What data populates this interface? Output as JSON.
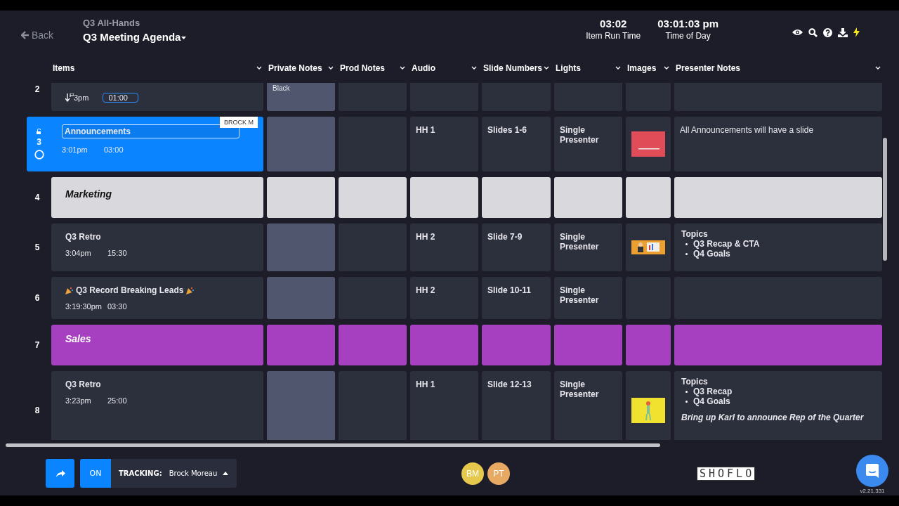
{
  "header": {
    "back": {
      "label": "Back",
      "disabled": true
    },
    "show": "Q3 All-Hands",
    "rundown": "Q3 Meeting Agenda",
    "timers": [
      {
        "value": "03:02",
        "label": "Item Run Time"
      },
      {
        "value": "03:01:03 pm",
        "label": "Time of Day"
      }
    ]
  },
  "columns": [
    "Items",
    "Private Notes",
    "Prod Notes",
    "Audio",
    "Slide Numbers",
    "Lights",
    "Images",
    "Presenter Notes"
  ],
  "rows": [
    {
      "number": "2",
      "kind": "item",
      "selected": false,
      "title": "",
      "start": "3pm",
      "start_icon": true,
      "duration": "01:00",
      "duration_editing": true,
      "private_notes": "Black",
      "prod_notes": "",
      "audio": "",
      "slide_numbers": "",
      "lights": ""
    },
    {
      "number": "3",
      "kind": "item",
      "selected": true,
      "tracker": "BROCK M",
      "title": "Announcements",
      "party": false,
      "start_icon": false,
      "title_editing": true,
      "start": "3:01pm",
      "duration": "03:00",
      "duration_editing": false,
      "private_notes": "",
      "prod_notes": "",
      "audio": "HH 1",
      "slide_numbers": "Slides 1-6",
      "lights": "Single Presenter",
      "image": {
        "kind": "slide"
      },
      "presenter_notes": {
        "kind": "text",
        "text": "All Announcements will have a slide"
      }
    },
    {
      "number": "4",
      "kind": "section",
      "title": "Marketing",
      "color": "#d9d9dd"
    },
    {
      "number": "5",
      "kind": "item",
      "selected": false,
      "title": "Q3 Retro",
      "party": false,
      "start_icon": false,
      "title_editing": false,
      "start": "3:04pm",
      "duration": "15:30",
      "duration_editing": false,
      "private_notes": "",
      "prod_notes": "",
      "audio": "HH 2",
      "slide_numbers": "Slide 7-9",
      "lights": "Single Presenter",
      "image": {
        "kind": "presenter"
      },
      "presenter_notes": {
        "kind": "topics",
        "heading": "Topics",
        "bullets": [
          "Q3 Recap & CTA",
          "Q4 Goals"
        ]
      }
    },
    {
      "number": "6",
      "kind": "item",
      "selected": false,
      "title": "Q3 Record Breaking Leads",
      "party": true,
      "start_icon": false,
      "title_editing": false,
      "start": "3:19:30pm",
      "duration": "03:30",
      "duration_editing": false,
      "private_notes": "",
      "prod_notes": "",
      "audio": "HH 2",
      "slide_numbers": "Slide 10-11",
      "lights": "Single Presenter"
    },
    {
      "number": "7",
      "kind": "section",
      "title": "Sales",
      "color": "#a640c1"
    },
    {
      "number": "8",
      "kind": "item",
      "selected": false,
      "title": "Q3 Retro",
      "party": false,
      "start_icon": false,
      "title_editing": false,
      "start": "3:23pm",
      "duration": "25:00",
      "duration_editing": false,
      "private_notes": "",
      "prod_notes": "",
      "audio": "HH 1",
      "slide_numbers": "Slide 12-13",
      "lights": "Single Presenter",
      "image": {
        "kind": "figure"
      },
      "presenter_notes": {
        "kind": "topics",
        "heading": "Topics",
        "bullets": [
          "Q3 Recap",
          "Q4 Goals"
        ],
        "note": "Bring up Karl to announce Rep of the Quarter"
      }
    }
  ],
  "footer": {
    "tracking": {
      "on": true,
      "toggle_label": "ON",
      "label": "TRACKING:",
      "name": "Brock Moreau"
    },
    "users": [
      {
        "initials": "BM",
        "color": "#e6c94c"
      },
      {
        "initials": "PT",
        "color": "#e8a962"
      }
    ],
    "logo": "SHOFLO",
    "version": "v2.21.331"
  }
}
